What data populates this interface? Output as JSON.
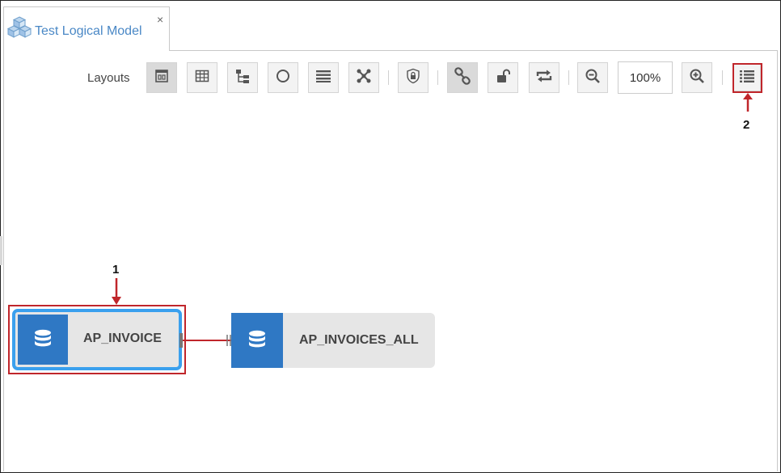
{
  "tab": {
    "title": "Test Logical Model",
    "close_glyph": "×",
    "icon": "cubes-icon"
  },
  "toolbar": {
    "label": "Layouts",
    "buttons": [
      {
        "name": "layout-freeform-button",
        "icon": "freeform-layout-icon"
      },
      {
        "name": "layout-grid-button",
        "icon": "grid-layout-icon"
      },
      {
        "name": "layout-tree-button",
        "icon": "tree-layout-icon"
      },
      {
        "name": "layout-circular-button",
        "icon": "circle-layout-icon"
      },
      {
        "name": "layout-list-button",
        "icon": "list-layout-icon"
      },
      {
        "name": "layout-organic-button",
        "icon": "organic-layout-icon"
      },
      {
        "name": "security-button",
        "icon": "shield-lock-icon"
      },
      {
        "name": "join-button",
        "icon": "link-icon"
      },
      {
        "name": "unlock-button",
        "icon": "unlock-icon"
      },
      {
        "name": "refresh-button",
        "icon": "refresh-icon"
      },
      {
        "name": "zoom-out-button",
        "icon": "zoom-out-icon"
      },
      {
        "name": "zoom-in-button",
        "icon": "zoom-in-icon"
      },
      {
        "name": "properties-list-button",
        "icon": "list-icon"
      }
    ],
    "zoom_value": "100%"
  },
  "diagram": {
    "nodes": [
      {
        "label": "AP_INVOICE",
        "icon": "database-icon",
        "selected": true
      },
      {
        "label": "AP_INVOICES_ALL",
        "icon": "database-icon",
        "selected": false
      }
    ],
    "join": {
      "from": "AP_INVOICE",
      "to": "AP_INVOICES_ALL"
    }
  },
  "callouts": [
    {
      "number": "1",
      "target": "AP_INVOICE"
    },
    {
      "number": "2",
      "target": "properties-list-button"
    }
  ],
  "colors": {
    "accent": "#2f78c4",
    "callout": "#c0262b",
    "tab_title": "#4a88c6"
  }
}
